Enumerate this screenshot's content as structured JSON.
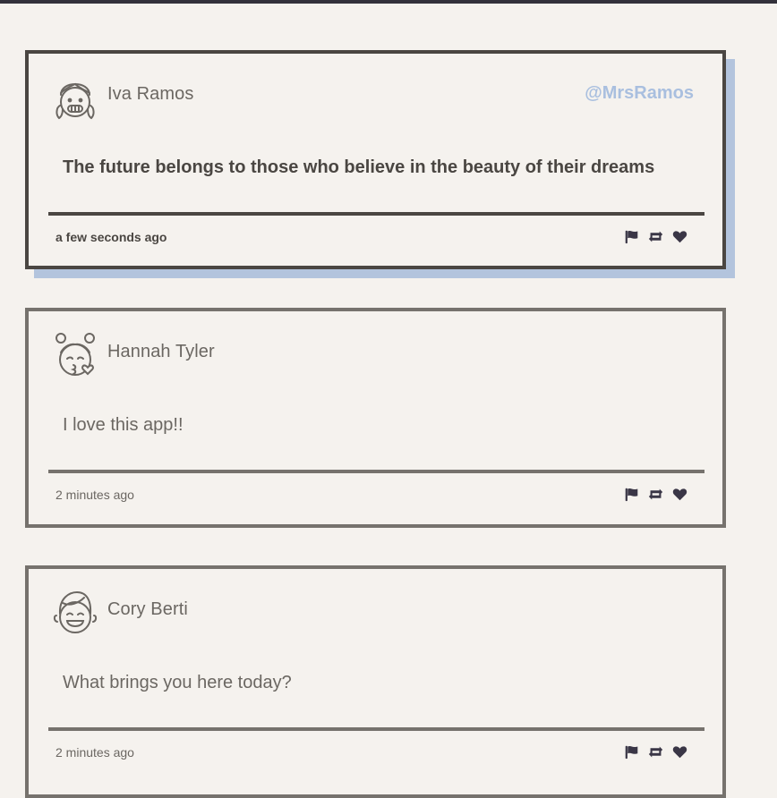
{
  "feed": {
    "posts": [
      {
        "name": "Iva Ramos",
        "handle": "@MrsRamos",
        "avatar_icon": "girl-braids-grin-icon",
        "message": "The future belongs to those who believe in the beauty of their dreams",
        "time": "a few seconds ago"
      },
      {
        "name": "Hannah Tyler",
        "avatar_icon": "girl-kiss-heart-icon",
        "message": "I love this app!!",
        "time": "2 minutes ago"
      },
      {
        "name": "Cory Berti",
        "avatar_icon": "boy-laughing-icon",
        "message": "What brings you here today?",
        "time": "2 minutes ago"
      }
    ],
    "action_icons": [
      "flag-icon",
      "retweet-icon",
      "heart-icon"
    ]
  },
  "colors": {
    "background": "#f5f2ee",
    "top_bar": "#33313b",
    "featured_border": "#4a4642",
    "card_border": "#76726d",
    "featured_shadow": "#b3c4dd",
    "handle": "#a9bfdf",
    "icon": "#3a3646"
  }
}
